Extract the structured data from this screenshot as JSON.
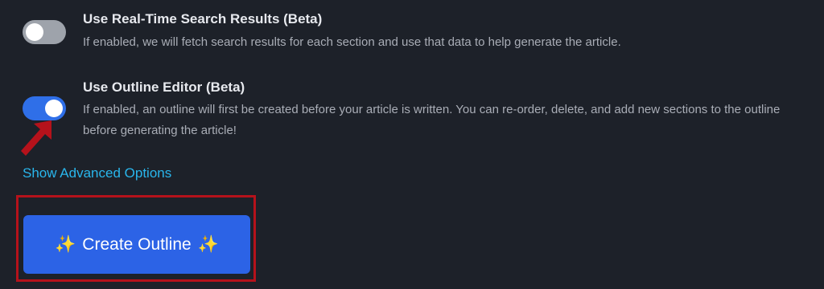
{
  "options": [
    {
      "title": "Use Real-Time Search Results (Beta)",
      "description": "If enabled, we will fetch search results for each section and use that data to help generate the article.",
      "enabled": false
    },
    {
      "title": "Use Outline Editor (Beta)",
      "description": "If enabled, an outline will first be created before your article is written. You can re-order, delete, and add new sections to the outline before generating the article!",
      "enabled": true
    }
  ],
  "advanced_link": "Show Advanced Options",
  "create_button": {
    "label": "Create Outline",
    "icon": "sparkles-icon"
  },
  "colors": {
    "background": "#1d2129",
    "toggle_on": "#2f6fe8",
    "toggle_off": "#9ea3ab",
    "link": "#29b6ec",
    "button": "#2c63e6",
    "annotation_red": "#b5121b"
  }
}
